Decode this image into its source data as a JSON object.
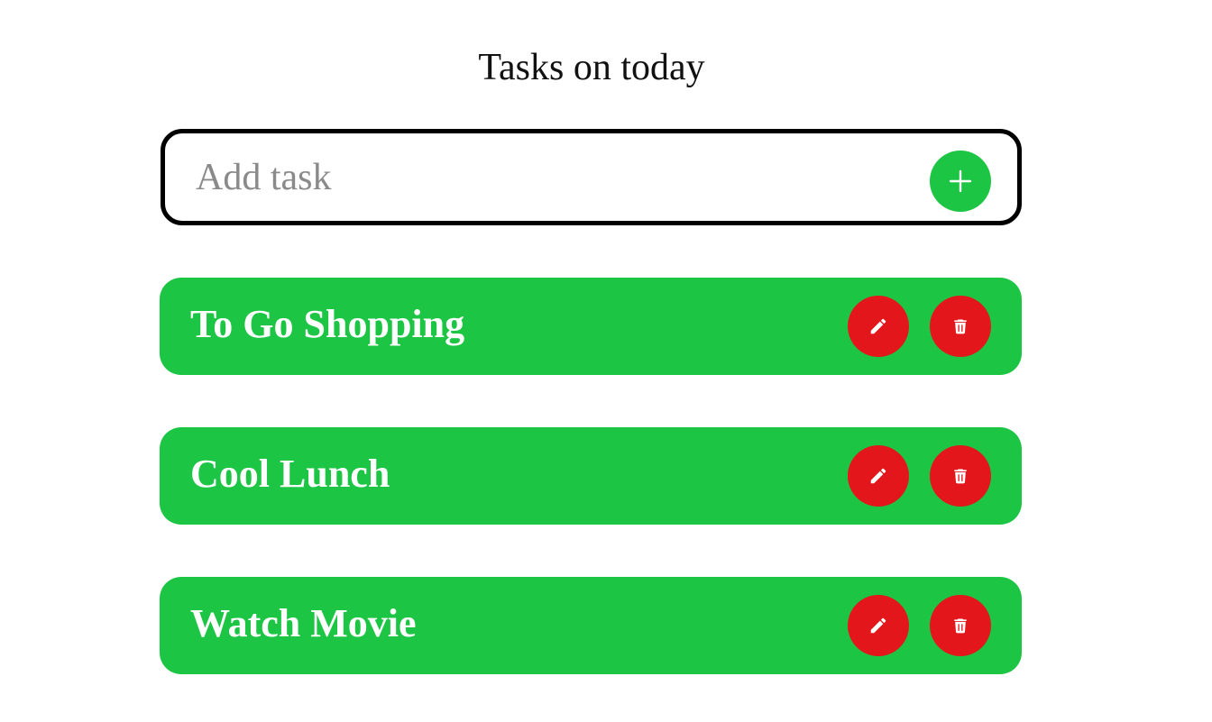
{
  "header": {
    "title": "Tasks on today"
  },
  "add_task": {
    "placeholder": "Add task",
    "value": "",
    "button_icon": "plus-icon"
  },
  "tasks": [
    {
      "label": "To Go Shopping",
      "edit_icon": "pencil-icon",
      "delete_icon": "trash-icon"
    },
    {
      "label": "Cool Lunch",
      "edit_icon": "pencil-icon",
      "delete_icon": "trash-icon"
    },
    {
      "label": "Watch Movie",
      "edit_icon": "pencil-icon",
      "delete_icon": "trash-icon"
    }
  ],
  "colors": {
    "task_background": "#1dc544",
    "add_button": "#1dc544",
    "action_button": "#e3171b",
    "input_border": "#000000",
    "icon": "#ffffff"
  }
}
